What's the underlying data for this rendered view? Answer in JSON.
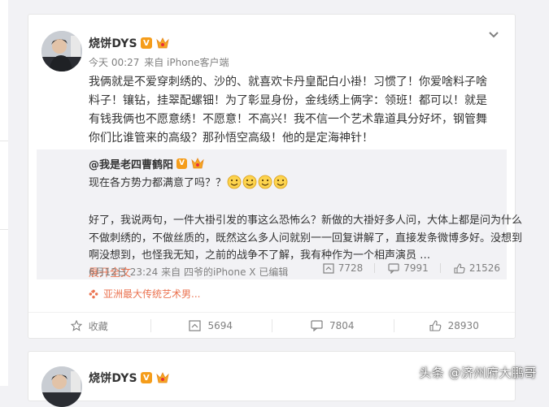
{
  "post": {
    "user": {
      "name": "烧饼DYS",
      "verified_badge": "V"
    },
    "meta": {
      "time": "今天 00:27",
      "source": "来自 iPhone客户端"
    },
    "text_lines": [
      "我俩就是不爱穿刺绣的、沙的、就喜欢卡丹皇配白小褂！习惯了！你爱啥料子啥",
      "料子！镶钻，挂翠配螺钿！为了彰显身份，金线绣上俩字：领班！都可以！就是",
      "有钱我俩也不愿意绣！不愿意！不高兴！我不信一个艺术靠道具分好坏，钢管舞",
      "你们比谁管来的高级？那孙悟空高级！他的是定海神针！"
    ],
    "repost": {
      "user": {
        "name": "@我是老四曹鹤阳",
        "verified_badge": "V"
      },
      "comment": "现在各方势力都满意了吗？？",
      "body_lines": [
        "好了，我说两句，一件大褂引发的事这么恐怖么？新做的大褂好多人问，大体上都是问为什么",
        "不做刺绣的，不做丝质的，既然这么多人问就别一一回复讲解了，直接发条微博多好。没想到",
        "啊没想到，也怪我无知，之前的战争不了解，我有种作为一个相声演员 …"
      ],
      "expand_link": "展开全文",
      "expand_arrow": "⌄",
      "meta": {
        "date": "6月12日 23:24",
        "source": "来自 四爷的iPhone X",
        "edited": "已编辑"
      },
      "stats": {
        "forward": "7728",
        "comment": "7991",
        "like": "21526"
      }
    },
    "tag": "亚洲最大传统艺术男...",
    "actions": {
      "favorite": "收藏",
      "forward": "5694",
      "comment": "7804",
      "like": "28930"
    }
  },
  "next_post": {
    "user": {
      "name": "烧饼DYS",
      "verified_badge": "V"
    }
  },
  "watermark": "头条 @济州府大鹏哥",
  "colors": {
    "link": "#eb7350",
    "badge_orange": "#f59d1b",
    "page_bg": "#f2f2f5"
  },
  "icons": [
    "chevron-down-icon",
    "emoji-smile-icon",
    "forward-icon",
    "comment-icon",
    "like-icon",
    "favorite-icon",
    "tag-flower-icon",
    "vip-icon"
  ]
}
